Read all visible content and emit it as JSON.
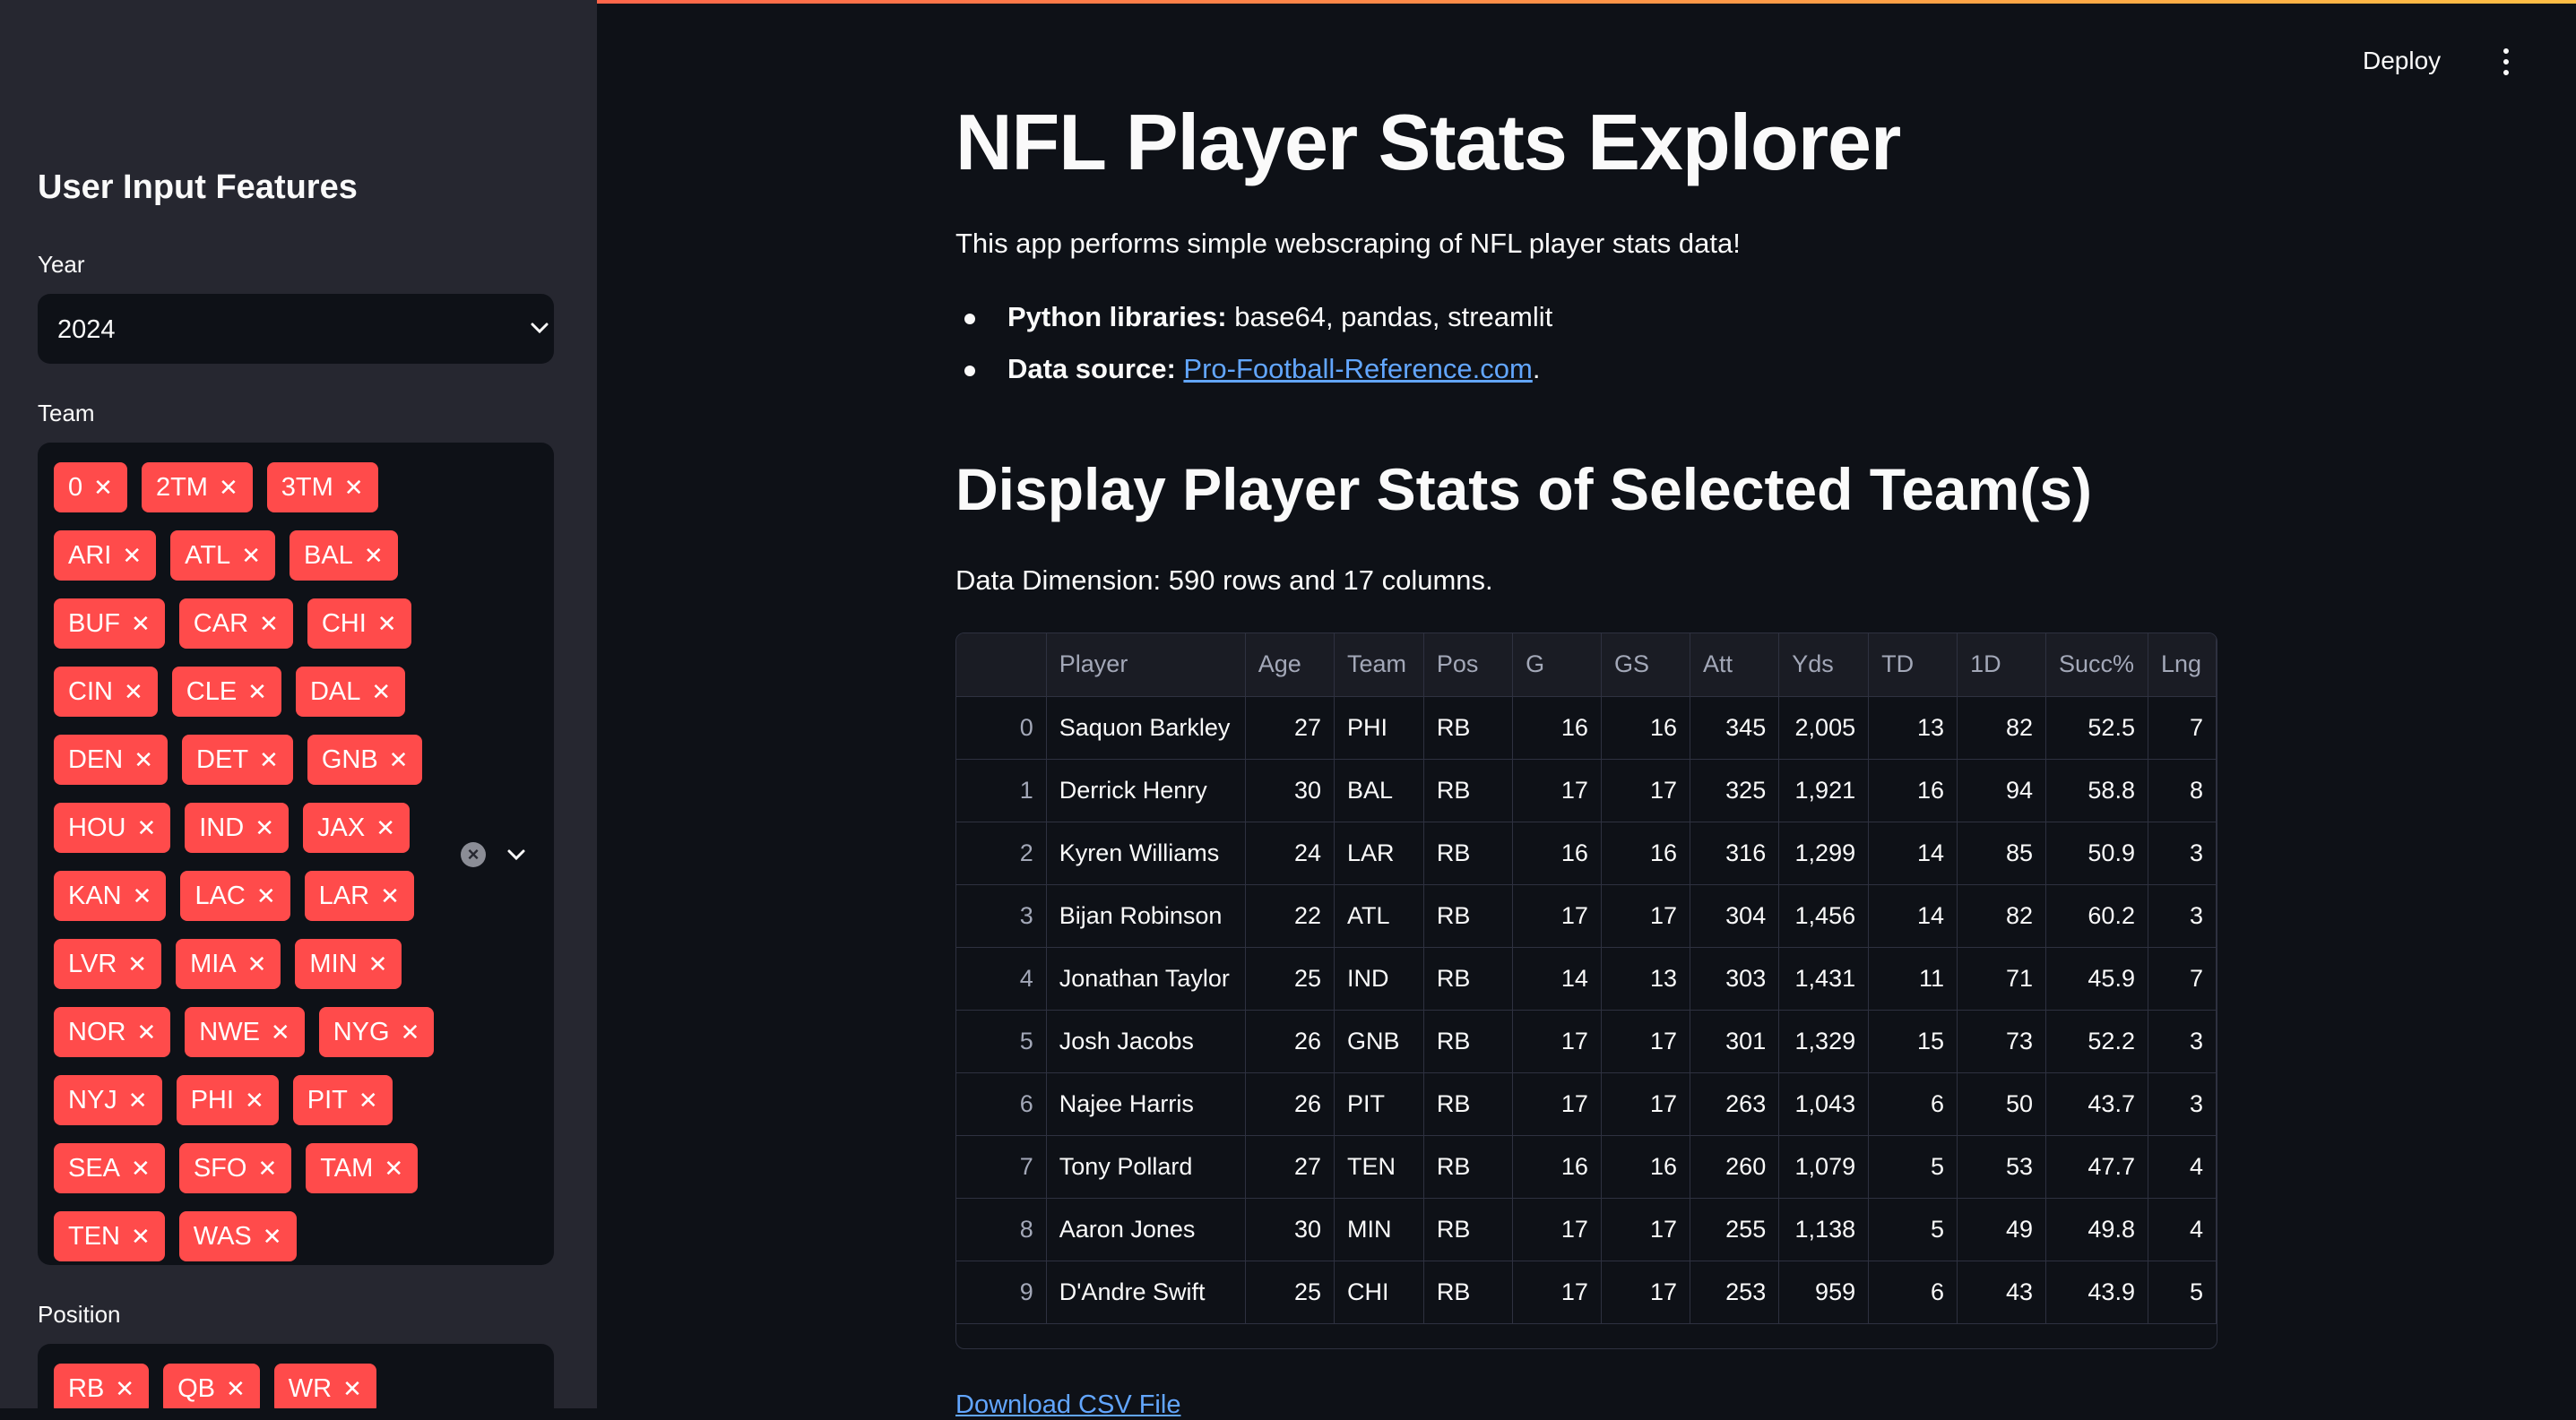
{
  "sidebar": {
    "title": "User Input Features",
    "year": {
      "label": "Year",
      "value": "2024"
    },
    "team": {
      "label": "Team",
      "chip_rows": [
        [
          "0",
          "2TM",
          "3TM"
        ],
        [
          "ARI",
          "ATL",
          "BAL"
        ],
        [
          "BUF",
          "CAR",
          "CHI"
        ],
        [
          "CIN",
          "CLE",
          "DAL"
        ],
        [
          "DEN",
          "DET",
          "GNB"
        ],
        [
          "HOU",
          "IND",
          "JAX"
        ],
        [
          "KAN",
          "LAC",
          "LAR"
        ],
        [
          "LVR",
          "MIA",
          "MIN"
        ],
        [
          "NOR",
          "NWE",
          "NYG"
        ],
        [
          "NYJ",
          "PHI",
          "PIT"
        ],
        [
          "SEA",
          "SFO",
          "TAM"
        ],
        [
          "TEN",
          "WAS"
        ]
      ]
    },
    "position": {
      "label": "Position",
      "chips": [
        "RB",
        "QB",
        "WR"
      ]
    }
  },
  "header": {
    "deploy_label": "Deploy"
  },
  "main": {
    "title": "NFL Player Stats Explorer",
    "intro": "This app performs simple webscraping of NFL player stats data!",
    "bullets": [
      {
        "key": "Python libraries:",
        "text": "base64, pandas, streamlit"
      },
      {
        "key": "Data source:",
        "link": "Pro-Football-Reference.com",
        "suffix": "."
      }
    ],
    "section_title": "Display Player Stats of Selected Team(s)",
    "dimension": "Data Dimension: 590 rows and 17 columns.",
    "download_label": "Download CSV File"
  },
  "table": {
    "columns": [
      "",
      "Player",
      "Age",
      "Team",
      "Pos",
      "G",
      "GS",
      "Att",
      "Yds",
      "TD",
      "1D",
      "Succ%",
      "Lng"
    ],
    "rows": [
      [
        "0",
        "Saquon Barkley",
        "27",
        "PHI",
        "RB",
        "16",
        "16",
        "345",
        "2,005",
        "13",
        "82",
        "52.5",
        "7"
      ],
      [
        "1",
        "Derrick Henry",
        "30",
        "BAL",
        "RB",
        "17",
        "17",
        "325",
        "1,921",
        "16",
        "94",
        "58.8",
        "8"
      ],
      [
        "2",
        "Kyren Williams",
        "24",
        "LAR",
        "RB",
        "16",
        "16",
        "316",
        "1,299",
        "14",
        "85",
        "50.9",
        "3"
      ],
      [
        "3",
        "Bijan Robinson",
        "22",
        "ATL",
        "RB",
        "17",
        "17",
        "304",
        "1,456",
        "14",
        "82",
        "60.2",
        "3"
      ],
      [
        "4",
        "Jonathan Taylor",
        "25",
        "IND",
        "RB",
        "14",
        "13",
        "303",
        "1,431",
        "11",
        "71",
        "45.9",
        "7"
      ],
      [
        "5",
        "Josh Jacobs",
        "26",
        "GNB",
        "RB",
        "17",
        "17",
        "301",
        "1,329",
        "15",
        "73",
        "52.2",
        "3"
      ],
      [
        "6",
        "Najee Harris",
        "26",
        "PIT",
        "RB",
        "17",
        "17",
        "263",
        "1,043",
        "6",
        "50",
        "43.7",
        "3"
      ],
      [
        "7",
        "Tony Pollard",
        "27",
        "TEN",
        "RB",
        "16",
        "16",
        "260",
        "1,079",
        "5",
        "53",
        "47.7",
        "4"
      ],
      [
        "8",
        "Aaron Jones",
        "30",
        "MIN",
        "RB",
        "17",
        "17",
        "255",
        "1,138",
        "5",
        "49",
        "49.8",
        "4"
      ],
      [
        "9",
        "D'Andre Swift",
        "25",
        "CHI",
        "RB",
        "17",
        "17",
        "253",
        "959",
        "6",
        "43",
        "43.9",
        "5"
      ]
    ]
  }
}
